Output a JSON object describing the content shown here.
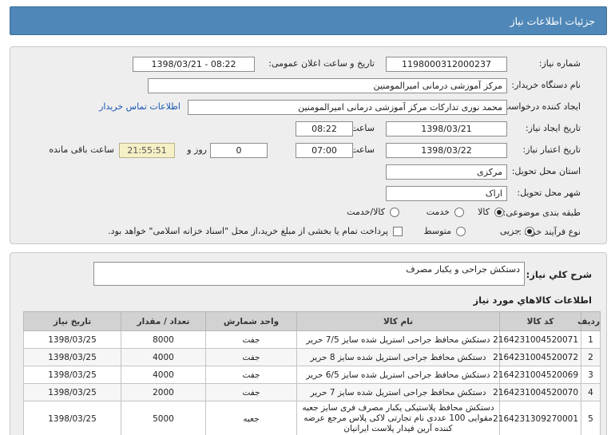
{
  "header": {
    "title": "جزئیات اطلاعات نیاز"
  },
  "details": {
    "need_number_label": "شماره نیاز:",
    "need_number": "1198000312000237",
    "announce_label": "تاریخ و ساعت اعلان عمومی:",
    "announce_value": "1398/03/21 - 08:22",
    "buyer_label": "نام دستگاه خریدار:",
    "buyer_value": "مرکز آموزشی درمانی امیرالمومنین",
    "requester_label": "ایجاد کننده درخواست:",
    "requester_value": "محمد نوری تدارکات مرکز آموزشی درمانی امیرالمومنین",
    "contact_link": "اطلاعات تماس خریدار",
    "created_label": "تاریخ ایجاد نیاز:",
    "created_date": "1398/03/21",
    "time_label": "ساعت",
    "created_time": "08:22",
    "validity_label": "تاریخ اعتبار نیاز:",
    "validity_date": "1398/03/22",
    "validity_time": "07:00",
    "days_value": "0",
    "days_label": "روز و",
    "remaining_time": "21:55:51",
    "remaining_label": "ساعت باقی مانده",
    "province_label": "استان محل تحویل:",
    "province_value": "مرکزی",
    "city_label": "شهر محل تحویل:",
    "city_value": "اراک",
    "category_label": "طبقه بندی موضوعی:",
    "category_options": [
      "کالا",
      "خدمت",
      "کالا/خدمت"
    ],
    "process_label": "نوع فرآیند خرید :",
    "process_options": [
      "جزیی",
      "متوسط"
    ],
    "payment_text": "پرداخت تمام یا بخشی از مبلغ خرید،از محل \"اسناد خزانه اسلامی\" خواهد بود."
  },
  "summary": {
    "label": "شرح کلي نياز:",
    "value": "دستکش جراحی و یکبار مصرف"
  },
  "goods": {
    "title": "اطلاعات کالاهاي مورد نياز",
    "columns": [
      "ردیف",
      "کد کالا",
      "نام کالا",
      "واحد شمارش",
      "تعداد / مقدار",
      "تاریخ نیاز"
    ],
    "rows": [
      [
        "1",
        "2164231004520071",
        "دستکش محافظ جراحی استریل شده سایز 7/5 حریر",
        "جفت",
        "8000",
        "1398/03/25"
      ],
      [
        "2",
        "2164231004520072",
        "دستکش محافظ جراحی استریل شده سایز 8 حریر",
        "جفت",
        "4000",
        "1398/03/25"
      ],
      [
        "3",
        "2164231004520069",
        "دستکش محافظ جراحی استریل شده سایز 6/5 حریر",
        "جفت",
        "4000",
        "1398/03/25"
      ],
      [
        "4",
        "2164231004520070",
        "دستکش محافظ جراحی استریل شده سایز 7 حریر",
        "جفت",
        "2000",
        "1398/03/25"
      ],
      [
        "5",
        "2164231309270001",
        "دستکش محافظ پلاستیکی یکبار مصرف فری سایز جعبه مقوایی 100 عددی نام تجارتی لاکی پلاس مرجع عرضه کننده آرین فیدار پلاست ایرانیان",
        "جعبه",
        "5000",
        "1398/03/25"
      ]
    ]
  }
}
